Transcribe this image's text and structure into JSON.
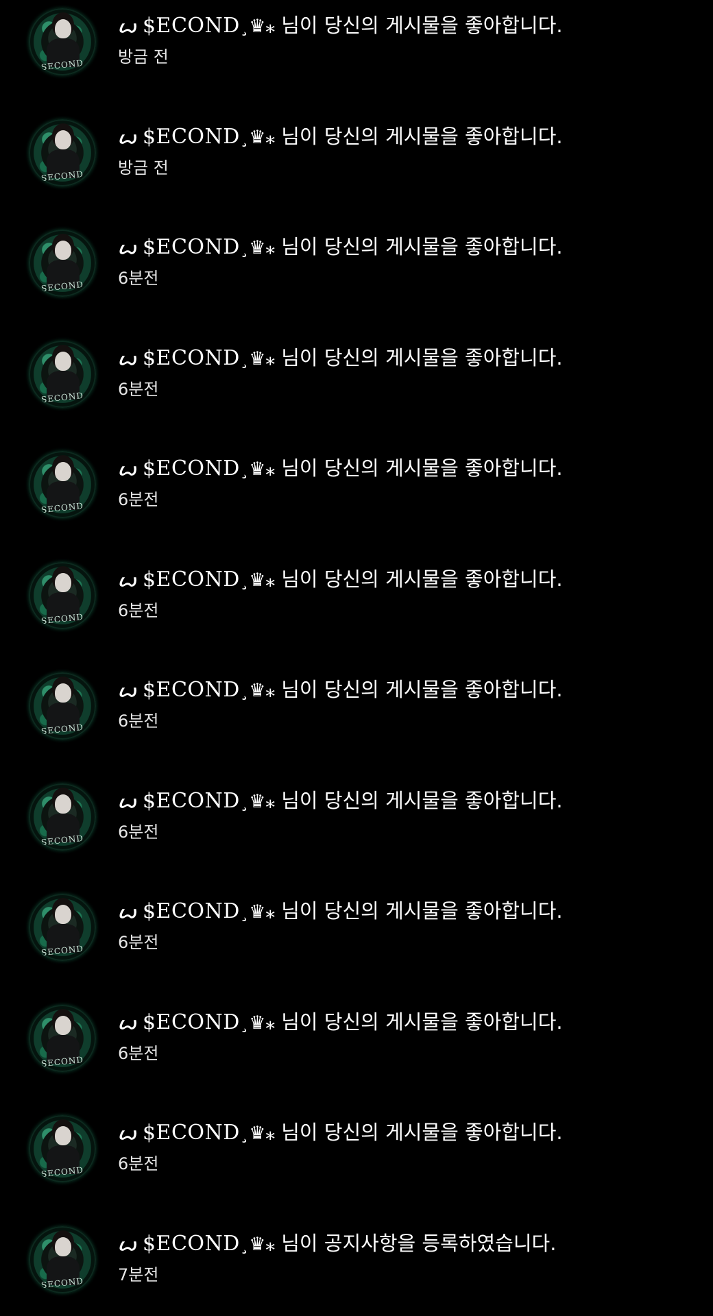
{
  "notifications": [
    {
      "user": {
        "deco": "ꙍ",
        "name": "$ECOND",
        "suffix": "¸♛⁎"
      },
      "message": "님이 당신의 게시물을 좋아합니다.",
      "time": "방금 전",
      "avatar_text": "SECOND"
    },
    {
      "user": {
        "deco": "ꙍ",
        "name": "$ECOND",
        "suffix": "¸♛⁎"
      },
      "message": "님이 당신의 게시물을 좋아합니다.",
      "time": "방금 전",
      "avatar_text": "SECOND"
    },
    {
      "user": {
        "deco": "ꙍ",
        "name": "$ECOND",
        "suffix": "¸♛⁎"
      },
      "message": "님이 당신의 게시물을 좋아합니다.",
      "time": "6분전",
      "avatar_text": "SECOND"
    },
    {
      "user": {
        "deco": "ꙍ",
        "name": "$ECOND",
        "suffix": "¸♛⁎"
      },
      "message": "님이 당신의 게시물을 좋아합니다.",
      "time": "6분전",
      "avatar_text": "SECOND"
    },
    {
      "user": {
        "deco": "ꙍ",
        "name": "$ECOND",
        "suffix": "¸♛⁎"
      },
      "message": "님이 당신의 게시물을 좋아합니다.",
      "time": "6분전",
      "avatar_text": "SECOND"
    },
    {
      "user": {
        "deco": "ꙍ",
        "name": "$ECOND",
        "suffix": "¸♛⁎"
      },
      "message": "님이 당신의 게시물을 좋아합니다.",
      "time": "6분전",
      "avatar_text": "SECOND"
    },
    {
      "user": {
        "deco": "ꙍ",
        "name": "$ECOND",
        "suffix": "¸♛⁎"
      },
      "message": "님이 당신의 게시물을 좋아합니다.",
      "time": "6분전",
      "avatar_text": "SECOND"
    },
    {
      "user": {
        "deco": "ꙍ",
        "name": "$ECOND",
        "suffix": "¸♛⁎"
      },
      "message": "님이 당신의 게시물을 좋아합니다.",
      "time": "6분전",
      "avatar_text": "SECOND"
    },
    {
      "user": {
        "deco": "ꙍ",
        "name": "$ECOND",
        "suffix": "¸♛⁎"
      },
      "message": "님이 당신의 게시물을 좋아합니다.",
      "time": "6분전",
      "avatar_text": "SECOND"
    },
    {
      "user": {
        "deco": "ꙍ",
        "name": "$ECOND",
        "suffix": "¸♛⁎"
      },
      "message": "님이 당신의 게시물을 좋아합니다.",
      "time": "6분전",
      "avatar_text": "SECOND"
    },
    {
      "user": {
        "deco": "ꙍ",
        "name": "$ECOND",
        "suffix": "¸♛⁎"
      },
      "message": "님이 당신의 게시물을 좋아합니다.",
      "time": "6분전",
      "avatar_text": "SECOND"
    },
    {
      "user": {
        "deco": "ꙍ",
        "name": "$ECOND",
        "suffix": "¸♛⁎"
      },
      "message": "님이 공지사항을 등록하였습니다.",
      "time": "7분전",
      "avatar_text": "SECOND"
    }
  ],
  "colors": {
    "background": "#000000",
    "text": "#ffffff",
    "time_text": "#e6e6e6",
    "avatar_green": "#1f7a57"
  }
}
